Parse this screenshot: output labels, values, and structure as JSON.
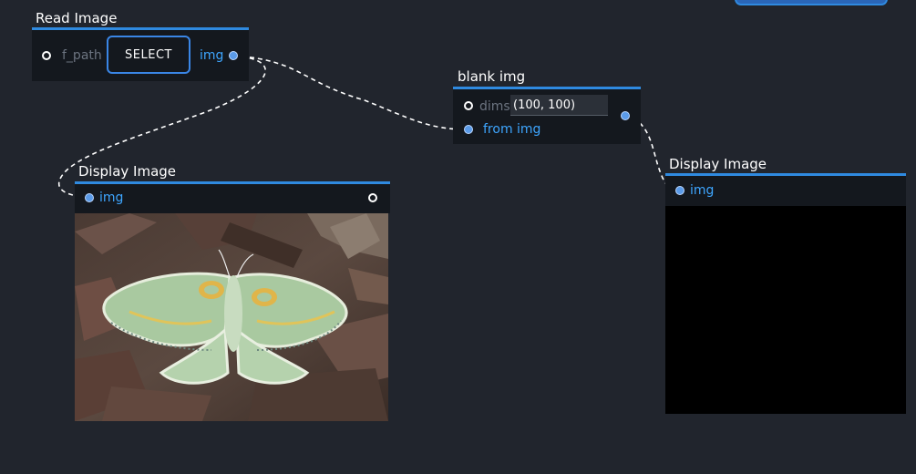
{
  "nodes": {
    "read_image": {
      "title": "Read Image",
      "input_label": "f_path",
      "button_label": "SELECT",
      "output_label": "img"
    },
    "blank_img": {
      "title": "blank img",
      "dims_label": "dims",
      "dims_value": "(100, 100)",
      "from_label": "from img"
    },
    "display_image_left": {
      "title": "Display Image",
      "input_label": "img"
    },
    "display_image_right": {
      "title": "Display Image",
      "input_label": "img"
    }
  },
  "colors": {
    "background": "#21252d",
    "node_body": "#14181e",
    "accent": "#2f8ae0",
    "port_label_blue": "#3ea6ff",
    "wire": "#ffffff"
  }
}
